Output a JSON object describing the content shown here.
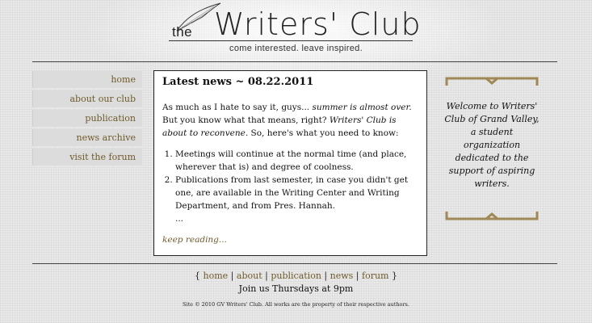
{
  "header": {
    "logo_the": "the",
    "logo_title": "Writers' Club",
    "tagline": "come interested. leave inspired."
  },
  "nav": {
    "items": [
      {
        "label": "home"
      },
      {
        "label": "about our club"
      },
      {
        "label": "publication"
      },
      {
        "label": "news archive"
      },
      {
        "label": "visit the forum"
      }
    ]
  },
  "main": {
    "title": "Latest news ~ 08.22.2011",
    "intro_1": "As much as I hate to say it, guys... ",
    "intro_em_1": "summer is almost over.",
    "intro_2": " But you know what that means, right? ",
    "intro_em_2": "Writers' Club is about to reconvene.",
    "intro_3": " So, here's what you need to know:",
    "list": [
      "Meetings will continue at the normal time (and place, wherever that is) and degree of coolness.",
      "Publications from last semester, in case you didn't get one, are available in the Writing Center and Writing Department, and from Pres. Hannah."
    ],
    "ellipsis": "...",
    "read_more": "keep reading..."
  },
  "welcome": {
    "text": "Welcome to Writers' Club of Grand Valley, a student organization dedicated to the support of aspiring writers."
  },
  "footer": {
    "brace_open": "{",
    "brace_close": "}",
    "separator": "|",
    "links": [
      {
        "label": "home"
      },
      {
        "label": "about"
      },
      {
        "label": "publication"
      },
      {
        "label": "news"
      },
      {
        "label": "forum"
      }
    ],
    "meeting": "Join us Thursdays at 9pm",
    "copyright": "Site © 2010 GV Writers' Club. All works are the property of their respective authors."
  },
  "colors": {
    "link": "#6f5b2b",
    "bracket": "#a08857"
  }
}
